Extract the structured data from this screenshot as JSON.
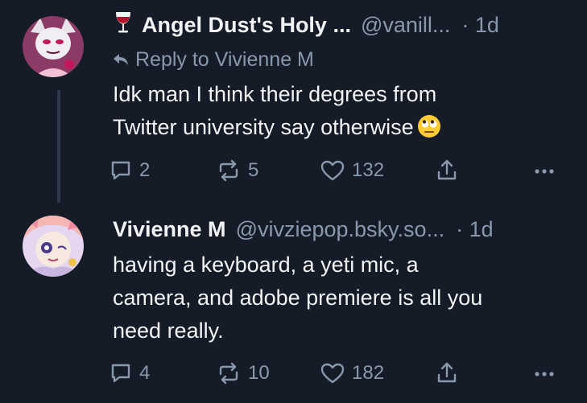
{
  "posts": [
    {
      "display_name": "Angel Dust's Holy ...",
      "handle": "@vanill...",
      "time": "· 1d",
      "name_emoji": "wine-glass-icon",
      "reply_to": "Reply to Vivienne M",
      "body_lines": [
        "Idk man I think their degrees from",
        "Twitter university say otherwise"
      ],
      "body_emoji": "rolling-eyes-emoji",
      "comments": "2",
      "reposts": "5",
      "likes": "132"
    },
    {
      "display_name": "Vivienne M",
      "handle": "@vivziepop.bsky.so...",
      "time": "· 1d",
      "body_lines": [
        "having a keyboard, a yeti mic, a",
        "camera, and adobe premiere is all you",
        "need really."
      ],
      "comments": "4",
      "reposts": "10",
      "likes": "182"
    }
  ],
  "colors": {
    "background": "#151c27",
    "text_primary": "#f1f3f5",
    "text_secondary": "#8a98ad",
    "thread_line": "#2e3a4c"
  }
}
